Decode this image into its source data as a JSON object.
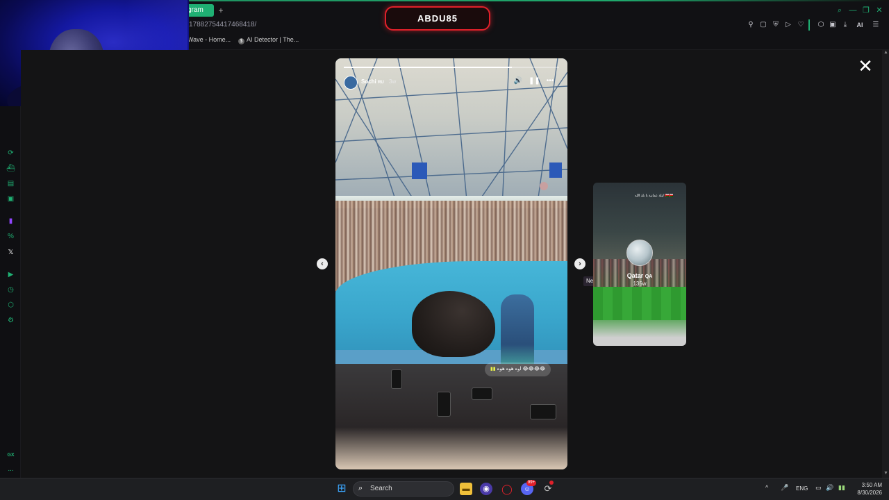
{
  "browser": {
    "active_tab_label": "gram",
    "new_tab_symbol": "+",
    "url_fragment": "17882754417468418/",
    "bookmarks": [
      {
        "label": "Wave - Home..."
      },
      {
        "label": "AI Detector | The..."
      }
    ],
    "brand_badge": "ABDU85",
    "toolbar_icons": [
      "pin-icon",
      "screenshot-icon",
      "shield-icon",
      "send-icon",
      "heart-icon",
      "extensions-icon",
      "wallet-icon",
      "download-icon",
      "ai-icon",
      "menu-icon"
    ],
    "ai_label": "AI",
    "window_icons": [
      "search-icon",
      "minimize-icon",
      "restore-icon",
      "close-icon"
    ],
    "accent_color": "#1fb073"
  },
  "sidebar": {
    "icons": [
      "chatgpt-icon",
      "ship-icon",
      "wallet-icon",
      "messenger-icon",
      "twitch-icon",
      "percent-icon",
      "x-icon",
      "play-icon",
      "history-icon",
      "extensions-icon",
      "settings-icon"
    ],
    "bottom_label": "GX",
    "more_symbol": "..."
  },
  "story": {
    "username": "Sochi",
    "location_tag": "RU",
    "time_ago": "3w",
    "caption": "اوه هوه هوه 😂😂😂😂",
    "progress_fraction": 0.78,
    "prev_symbol": "‹",
    "next_symbol": "›",
    "next_tooltip": "Next",
    "close_symbol": "✕"
  },
  "next_story": {
    "username": "Qatar",
    "location_tag": "QA",
    "time_ago": "135w",
    "caption": "ليلة عمانية يا بلد الله 🇴🇲🇴🇲"
  },
  "taskbar": {
    "search_label": "Search",
    "language": "ENG",
    "time": "3:50 AM",
    "date": "8/30/2026",
    "notification_badge": "99+"
  }
}
